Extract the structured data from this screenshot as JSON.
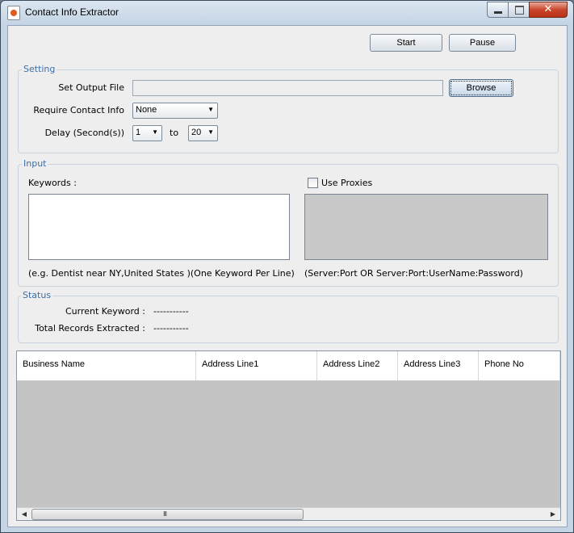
{
  "window": {
    "title": "Contact Info Extractor",
    "close_glyph": "✕"
  },
  "toolbar": {
    "start_label": "Start",
    "pause_label": "Pause"
  },
  "setting": {
    "title": "Setting",
    "output_file_label": "Set Output File",
    "output_file_value": "",
    "browse_label": "Browse",
    "require_label": "Require Contact Info",
    "require_value": "None",
    "delay_label": "Delay (Second(s))",
    "delay_from": "1",
    "delay_to_label": "to",
    "delay_to": "20"
  },
  "input": {
    "title": "Input",
    "keywords_label": "Keywords :",
    "keywords_value": "",
    "use_proxies_label": "Use Proxies",
    "use_proxies_checked": false,
    "keywords_hint": "(e.g. Dentist near NY,United States )(One Keyword Per Line)",
    "proxies_hint": "(Server:Port OR Server:Port:UserName:Password)"
  },
  "status": {
    "title": "Status",
    "current_keyword_label": "Current Keyword :",
    "current_keyword_value": "-----------",
    "total_records_label": "Total Records Extracted :",
    "total_records_value": "-----------"
  },
  "table": {
    "columns": [
      "Business Name",
      "Address Line1",
      "Address Line2",
      "Address Line3",
      "Phone No"
    ],
    "rows": [],
    "scroll_grip": "III"
  }
}
